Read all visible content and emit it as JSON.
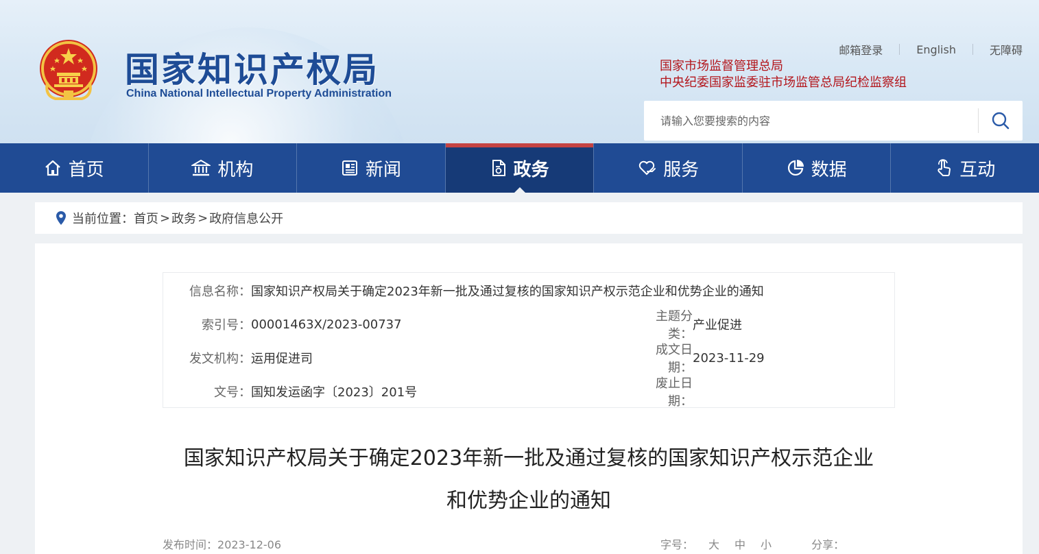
{
  "header": {
    "title": "国家知识产权局",
    "subtitle": "China National Intellectual Property Administration",
    "top_links": [
      "邮箱登录",
      "English",
      "无障碍"
    ],
    "related_links": [
      "国家市场监督管理总局",
      "中央纪委国家监委驻市场监管总局纪检监察组"
    ],
    "search_placeholder": "请输入您要搜索的内容"
  },
  "nav": {
    "items": [
      {
        "label": "首页",
        "icon": "home-icon"
      },
      {
        "label": "机构",
        "icon": "institution-icon"
      },
      {
        "label": "新闻",
        "icon": "newspaper-icon"
      },
      {
        "label": "政务",
        "icon": "document-icon",
        "active": true
      },
      {
        "label": "服务",
        "icon": "heart-hand-icon"
      },
      {
        "label": "数据",
        "icon": "pie-chart-icon"
      },
      {
        "label": "互动",
        "icon": "pointer-hand-icon"
      }
    ]
  },
  "breadcrumb": {
    "prefix": "当前位置：",
    "items": [
      "首页",
      "政务",
      "政府信息公开"
    ],
    "separator": ">"
  },
  "info": {
    "name_label": "信息名称：",
    "name_value": "国家知识产权局关于确定2023年新一批及通过复核的国家知识产权示范企业和优势企业的通知",
    "index_label": "索引号：",
    "index_value": "00001463X/2023-00737",
    "topic_label": "主题分类：",
    "topic_value": "产业促进",
    "issuer_label": "发文机构：",
    "issuer_value": "运用促进司",
    "date_label": "成文日期：",
    "date_value": "2023-11-29",
    "docno_label": "文号：",
    "docno_value": "国知发运函字〔2023〕201号",
    "expire_label": "废止日期：",
    "expire_value": ""
  },
  "article": {
    "title_line1": "国家知识产权局关于确定2023年新一批及通过复核的国家知识产权示范企业",
    "title_line2": "和优势企业的通知",
    "publish_label": "发布时间：",
    "publish_value": "2023-12-06",
    "font_size_label": "字号：",
    "font_sizes": [
      "大",
      "中",
      "小"
    ],
    "share_label": "分享："
  },
  "colors": {
    "nav_bg": "#204b94",
    "nav_active_bg": "#163a77",
    "nav_active_top": "#c44343",
    "title_blue": "#1e4c96",
    "related_red": "#b3151b"
  }
}
